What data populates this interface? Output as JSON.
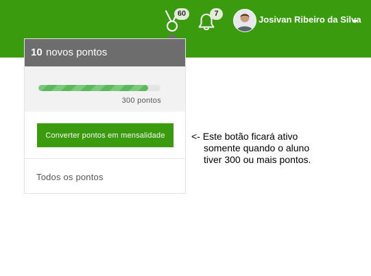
{
  "header": {
    "medal_icon": "medal-icon",
    "medal_badge": "60",
    "bell_icon": "bell-icon",
    "bell_badge": "7",
    "user_name": "Josivan Ribeiro da Silva",
    "accent_color": "#3a9b0e"
  },
  "points_dropdown": {
    "new_points_count": "10",
    "new_points_label": "novos pontos",
    "progress_fraction": 0.9,
    "progress_label": "300 pontos",
    "convert_button_label": "Converter pontos em mensalidade",
    "all_points_link": "Todos os pontos"
  },
  "annotation": {
    "line1": "<- Este botão ficará ativo",
    "line2": "somente quando o aluno",
    "line3": "tiver 300 ou mais pontos."
  }
}
